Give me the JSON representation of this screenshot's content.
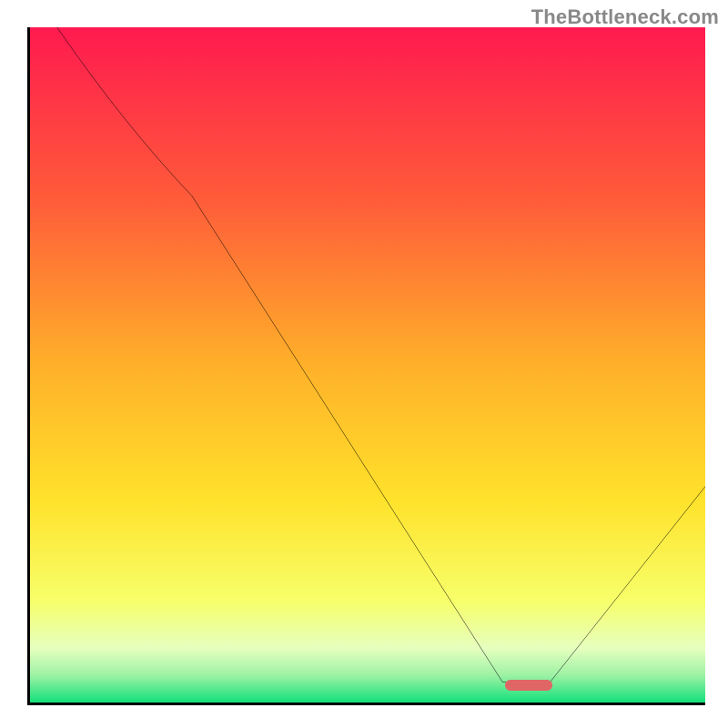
{
  "watermark": "TheBottleneck.com",
  "chart_data": {
    "type": "line",
    "title": "",
    "xlabel": "",
    "ylabel": "",
    "xlim": [
      0,
      100
    ],
    "ylim": [
      0,
      100
    ],
    "grid": false,
    "legend": false,
    "series": [
      {
        "name": "curve",
        "x": [
          4,
          24,
          70,
          77,
          100
        ],
        "values": [
          100,
          75,
          3,
          3,
          32
        ]
      }
    ],
    "marker": {
      "x_start": 70,
      "x_end": 77,
      "y": 3
    },
    "gradient_stops": [
      {
        "offset": 0.0,
        "color": "#ff1a4f"
      },
      {
        "offset": 0.25,
        "color": "#ff5a3a"
      },
      {
        "offset": 0.5,
        "color": "#ffb029"
      },
      {
        "offset": 0.7,
        "color": "#ffe22b"
      },
      {
        "offset": 0.85,
        "color": "#f7ff6a"
      },
      {
        "offset": 0.92,
        "color": "#e6ffbf"
      },
      {
        "offset": 0.96,
        "color": "#9cf2a4"
      },
      {
        "offset": 1.0,
        "color": "#13e07a"
      }
    ]
  }
}
